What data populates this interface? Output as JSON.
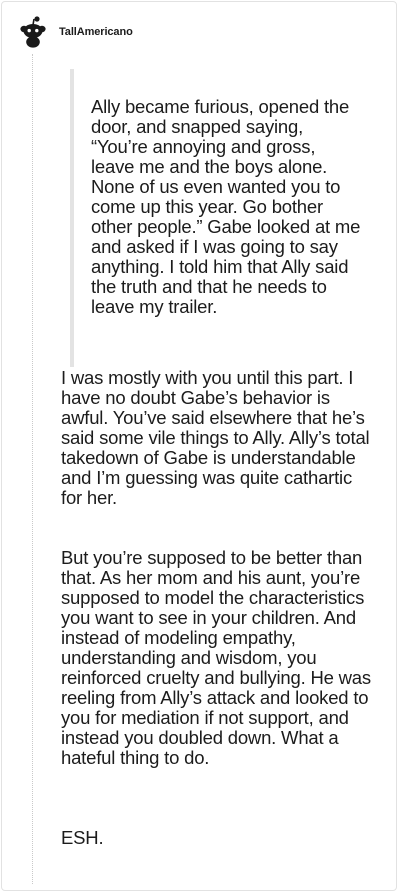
{
  "comment": {
    "author": "TallAmericano",
    "avatar_icon": "reddit-snoo-icon",
    "quote": "Ally became furious, opened the door, and snapped saying, “You’re annoying and gross, leave me and the boys alone. None of us even wanted you to come up this year. Go bother other people.” Gabe looked at me and asked if I was going to say anything. I told him that Ally said the truth and that he needs to leave my trailer.",
    "paragraphs": [
      "I was mostly with you until this part. I have no doubt Gabe’s behavior is awful. You’ve said elsewhere that he’s said some vile things to Ally. Ally’s total takedown of Gabe is understandable and I’m guessing was quite cathartic for her.",
      "But you’re supposed to be better than that. As her mom and his aunt, you’re supposed to model the characteristics you want to see in your children. And instead of modeling empathy, understanding and wisdom, you reinforced cruelty and bullying. He was reeling from Ally’s attack and looked to you for mediation if not support, and instead you doubled down. What a hateful thing to do.",
      "ESH."
    ]
  }
}
